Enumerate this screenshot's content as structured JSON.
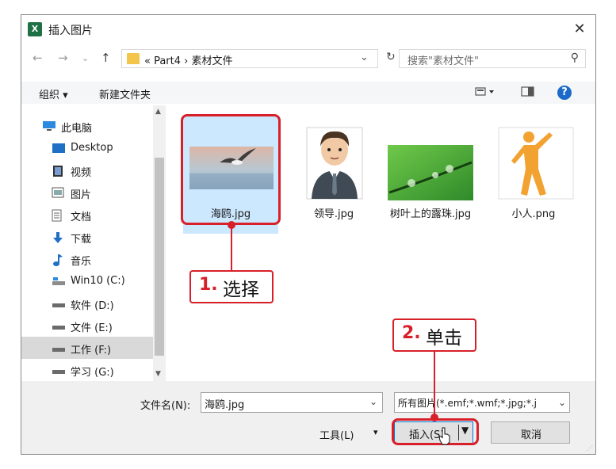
{
  "window": {
    "title": "插入图片",
    "app_icon": "X"
  },
  "nav": {
    "path": "« Part4 › 素材文件",
    "search_placeholder": "搜索\"素材文件\""
  },
  "toolbar": {
    "organize": "组织 ▾",
    "new_folder": "新建文件夹"
  },
  "sidebar": {
    "items": [
      {
        "label": "此电脑",
        "icon": "computer-icon"
      },
      {
        "label": "Desktop",
        "icon": "desktop-icon"
      },
      {
        "label": "视频",
        "icon": "video-icon"
      },
      {
        "label": "图片",
        "icon": "pictures-icon"
      },
      {
        "label": "文档",
        "icon": "documents-icon"
      },
      {
        "label": "下载",
        "icon": "download-icon"
      },
      {
        "label": "音乐",
        "icon": "music-icon"
      },
      {
        "label": "Win10 (C:)",
        "icon": "drive-icon"
      },
      {
        "label": "软件 (D:)",
        "icon": "drive-icon"
      },
      {
        "label": "文件 (E:)",
        "icon": "drive-icon"
      },
      {
        "label": "工作 (F:)",
        "icon": "drive-icon",
        "selected": true
      },
      {
        "label": "学习 (G:)",
        "icon": "drive-icon"
      }
    ]
  },
  "files": [
    {
      "name": "海鸥.jpg",
      "selected": true
    },
    {
      "name": "领导.jpg"
    },
    {
      "name": "树叶上的露珠.jpg"
    },
    {
      "name": "小人.png"
    }
  ],
  "bottom": {
    "filename_label": "文件名(N):",
    "filename_value": "海鸥.jpg",
    "filetype_value": "所有图片(*.emf;*.wmf;*.jpg;*.j",
    "tools_label": "工具(L)",
    "insert_label": "插入(S)",
    "cancel_label": "取消"
  },
  "annotations": {
    "step1_num": "1.",
    "step1_text": "选择",
    "step2_num": "2.",
    "step2_text": "单击",
    "color": "#d8202a"
  }
}
